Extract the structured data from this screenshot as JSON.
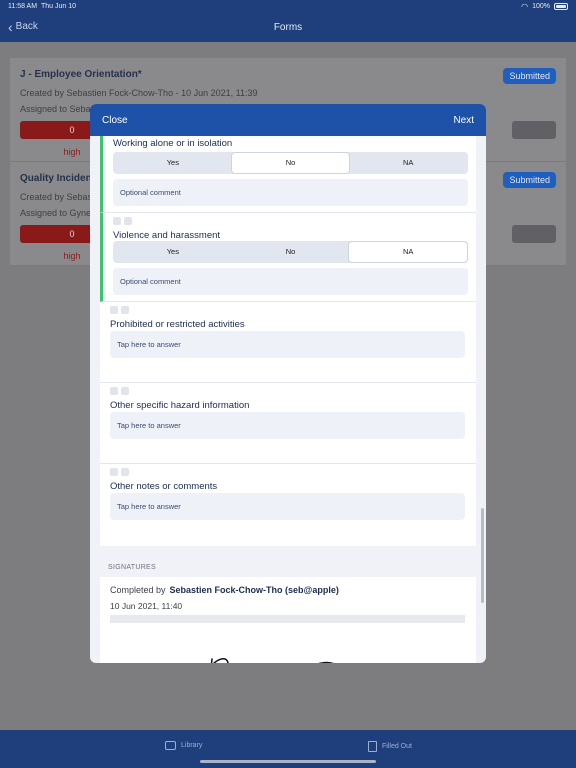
{
  "status_bar": {
    "time": "11:58 AM",
    "date": "Thu Jun 10",
    "battery": "100%"
  },
  "nav": {
    "back_label": "Back",
    "title": "Forms"
  },
  "background_list": {
    "items": [
      {
        "title": "J - Employee Orientation*",
        "created": "Created by Sebastien Fock-Chow-Tho - 10 Jun 2021, 11:39",
        "assigned": "Assigned to Seba",
        "status": "Submitted",
        "count": "0",
        "level": "high"
      },
      {
        "title": "Quality Incident",
        "created": "Created by Sebas",
        "assigned": "Assigned to Gyne",
        "status": "Submitted",
        "count": "0",
        "level": "high"
      }
    ]
  },
  "modal": {
    "close_label": "Close",
    "next_label": "Next",
    "questions": [
      {
        "title": "Working alone or in isolation",
        "options": [
          "Yes",
          "No",
          "NA"
        ],
        "selected": "No",
        "comment_placeholder": "Optional comment"
      },
      {
        "title": "Violence and harassment",
        "options": [
          "Yes",
          "No",
          "NA"
        ],
        "selected": "NA",
        "comment_placeholder": "Optional comment"
      },
      {
        "title": "Prohibited or restricted activities",
        "answer_placeholder": "Tap here to answer"
      },
      {
        "title": "Other specific hazard information",
        "answer_placeholder": "Tap here to answer"
      },
      {
        "title": "Other notes or comments",
        "answer_placeholder": "Tap here to answer"
      }
    ],
    "signatures": {
      "section_label": "SIGNATURES",
      "completed_prefix": "Completed by",
      "completed_by": "Sebastien Fock-Chow-Tho (seb@apple)",
      "date": "10 Jun 2021, 11:40"
    }
  },
  "tabbar": {
    "library_label": "Library",
    "filled_out_label": "Filled Out"
  },
  "colors": {
    "nav": "#1e3f7c",
    "modal_header": "#1e52a8",
    "accent_green": "#3cc46b",
    "badge": "#1f5fbd"
  }
}
